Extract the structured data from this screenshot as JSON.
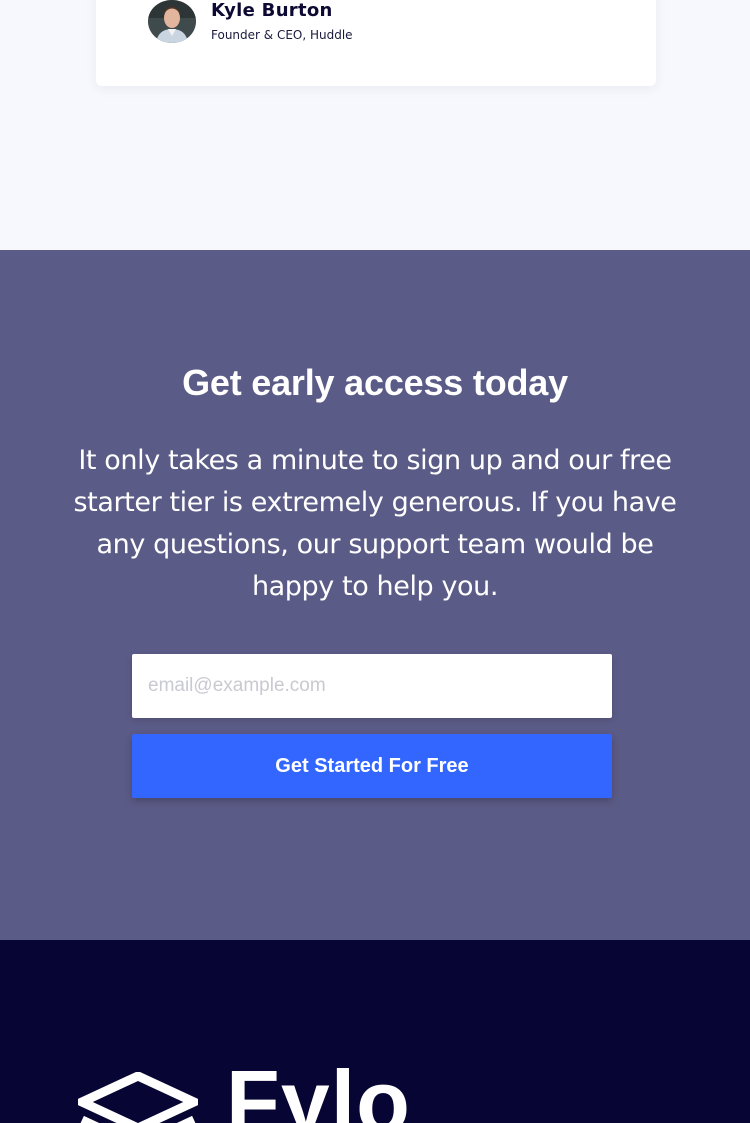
{
  "testimonial": {
    "author_name": "Kyle Burton",
    "author_role": "Founder & CEO, Huddle"
  },
  "cta": {
    "title": "Get early access today",
    "description": "It only takes a minute to sign up and our free starter tier is extremely generous. If you have any questions, our support team would be happy to help you.",
    "email_placeholder": "email@example.com",
    "email_value": "",
    "button_label": "Get Started For Free"
  },
  "footer": {
    "logo_text": "Fylo",
    "logo_icon": "fylo-logo-icon"
  },
  "colors": {
    "page_bg": "#f7f8fd",
    "cta_bg": "#5b5b87",
    "button_bg": "#3366ff",
    "footer_bg": "#070534",
    "text_dark": "#0c0a33"
  }
}
